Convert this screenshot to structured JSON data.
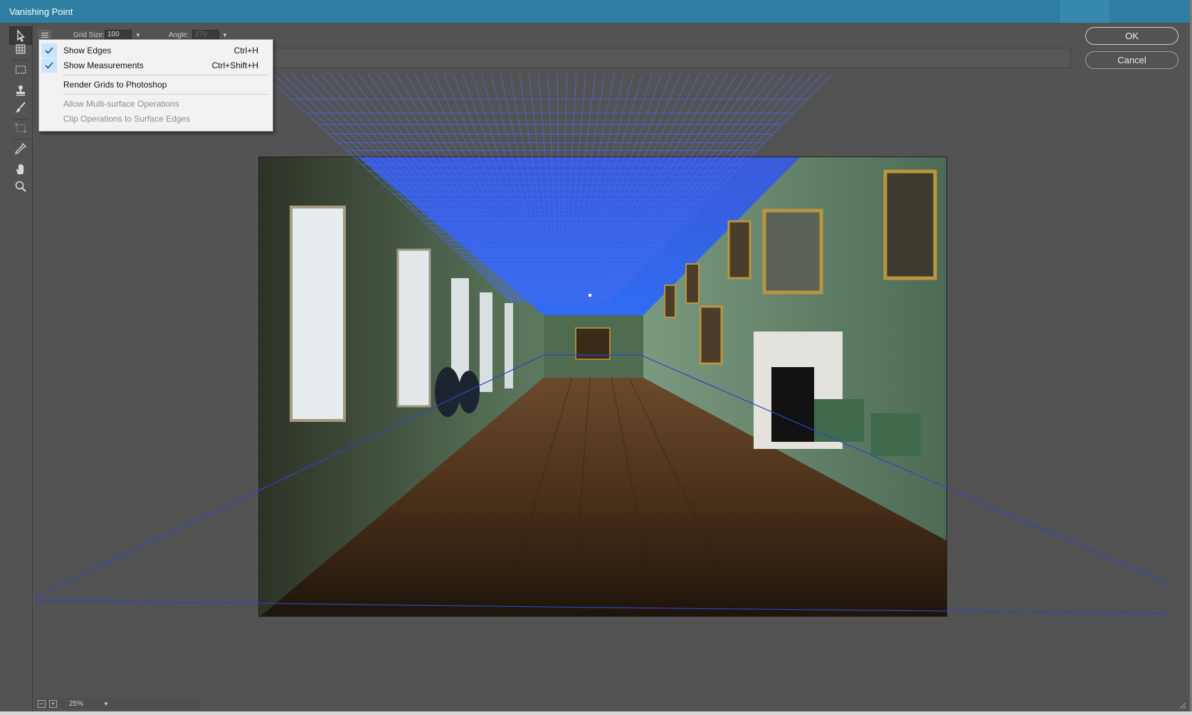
{
  "window": {
    "title": "Vanishing Point"
  },
  "tools": [
    {
      "name": "edit-plane-tool",
      "icon": "arrow-pointer-icon"
    },
    {
      "name": "create-plane-tool",
      "icon": "grid-plane-icon"
    },
    {
      "name": "marquee-tool",
      "icon": "marquee-icon"
    },
    {
      "name": "stamp-tool",
      "icon": "stamp-icon"
    },
    {
      "name": "brush-tool",
      "icon": "brush-icon"
    },
    {
      "name": "transform-tool",
      "icon": "transform-icon"
    },
    {
      "name": "eyedropper-tool",
      "icon": "eyedropper-icon"
    },
    {
      "name": "hand-tool",
      "icon": "hand-icon"
    },
    {
      "name": "zoom-tool",
      "icon": "magnifier-icon"
    }
  ],
  "options": {
    "grid_size_label": "Grid Size:",
    "grid_size_value": "100",
    "angle_label": "Angle:",
    "angle_value": "270"
  },
  "menu": {
    "items": [
      {
        "label": "Show Edges",
        "shortcut": "Ctrl+H",
        "checked": true
      },
      {
        "label": "Show Measurements",
        "shortcut": "Ctrl+Shift+H",
        "checked": true
      },
      {
        "label": "Render Grids to Photoshop",
        "shortcut": ""
      },
      {
        "label": "Allow Multi-surface Operations",
        "shortcut": "",
        "disabled": true
      },
      {
        "label": "Clip Operations to Surface Edges",
        "shortcut": "",
        "disabled": true
      }
    ]
  },
  "buttons": {
    "ok": "OK",
    "cancel": "Cancel"
  },
  "zoom": {
    "value": "25%"
  },
  "colors": {
    "titlebar": "#2d7ea0",
    "grid": "#4a6cf0",
    "edges": "#2a46c8"
  }
}
